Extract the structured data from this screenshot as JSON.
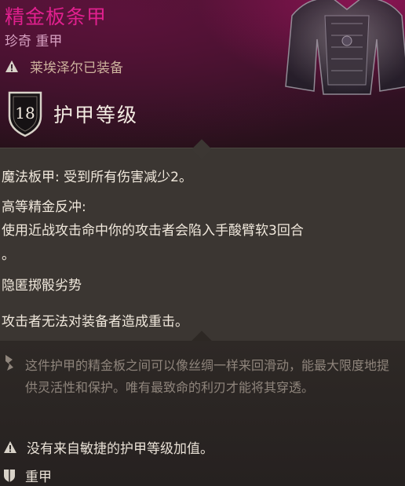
{
  "item": {
    "name": "精金板条甲",
    "rarity_type": "珍奇 重甲",
    "equipped_notice": "莱埃泽尔已装备",
    "armor_class_value": "18",
    "armor_class_label": "护甲等级",
    "name_color": "#e0208e"
  },
  "properties": {
    "line1": "魔法板甲: 受到所有伤害减少2。",
    "line2": "高等精金反冲:",
    "line3": "使用近战攻击命中你的攻击者会陷入手酸臂软3回合",
    "line4": "。",
    "line5": "隐匿掷骰劣势",
    "line6": "攻击者无法对装备者造成重击。"
  },
  "lore": {
    "text": "这件护甲的精金板之间可以像丝绸一样来回滑动，能最大限度地提供灵活性和保护。唯有最致命的利刃才能将其穿透。"
  },
  "footer": {
    "dex_notice": "没有来自敏捷的护甲等级加值。",
    "armor_type": "重甲"
  },
  "icons": {
    "warning": "warning-triangle-icon",
    "shield": "shield-icon",
    "lore": "lore-icon"
  }
}
